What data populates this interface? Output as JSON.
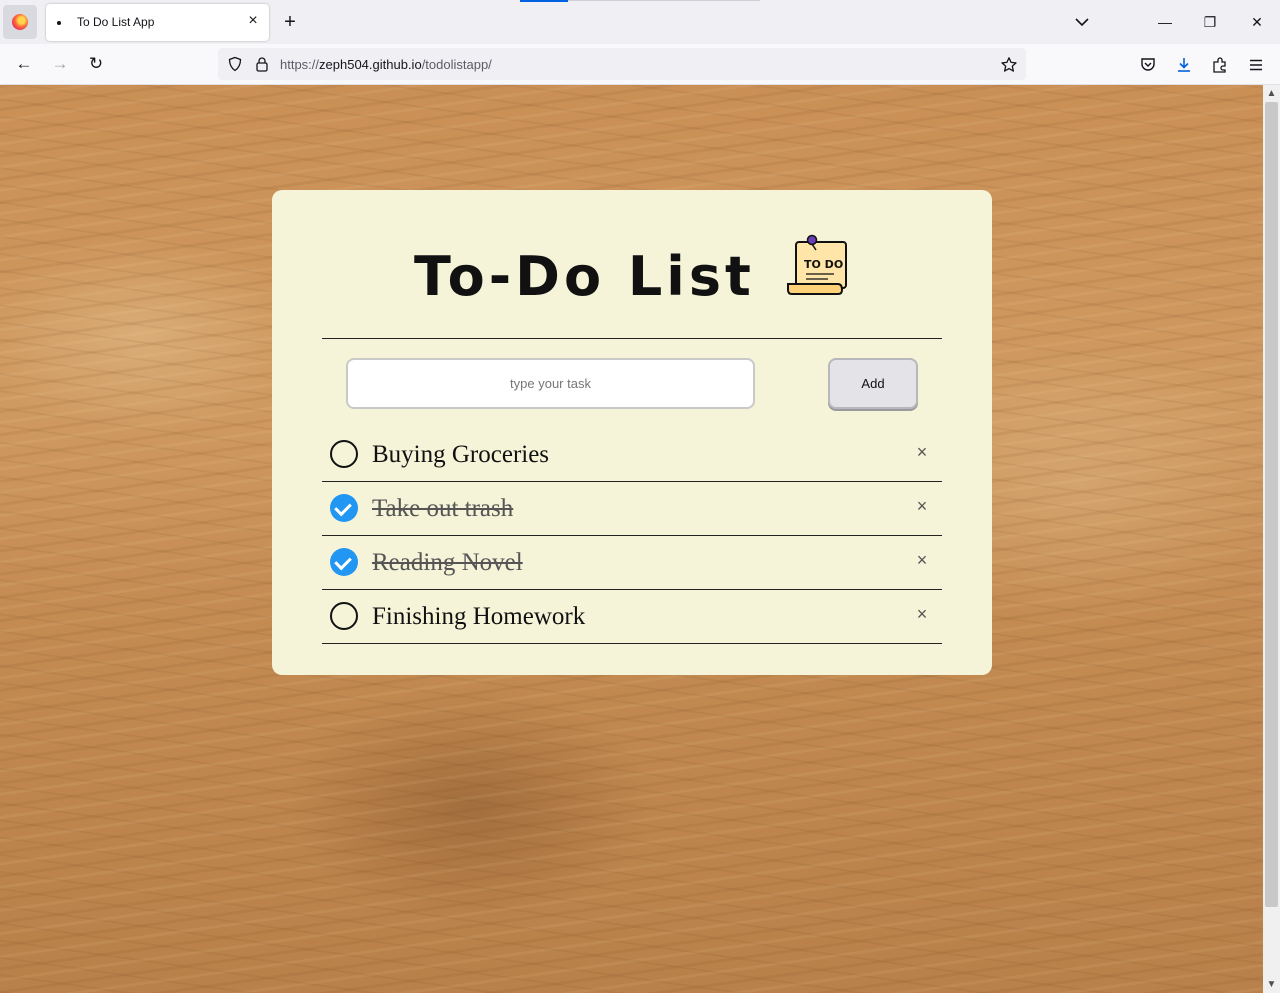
{
  "browser": {
    "tab": {
      "title": "To Do List App",
      "close_icon": "×"
    },
    "new_tab_icon": "+",
    "url": {
      "scheme": "https://",
      "host": "zeph504.github.io",
      "path": "/todolistapp/"
    },
    "nav": {
      "back_icon": "←",
      "forward_icon": "→",
      "reload_icon": "↻"
    },
    "window": {
      "minimize_icon": "—",
      "restore_icon": "❐",
      "close_icon": "✕"
    }
  },
  "app": {
    "title": "To-Do List",
    "title_icon_text": "TO DO",
    "input": {
      "placeholder": "type your task",
      "value": ""
    },
    "add_label": "Add",
    "delete_icon": "×",
    "tasks": [
      {
        "text": "Buying Groceries",
        "done": false
      },
      {
        "text": "Take out trash",
        "done": true
      },
      {
        "text": "Reading Novel",
        "done": true
      },
      {
        "text": "Finishing Homework",
        "done": false
      }
    ]
  },
  "colors": {
    "card_bg": "#f5f4d9",
    "check_done": "#2196f3",
    "accent": "#0061e0"
  }
}
